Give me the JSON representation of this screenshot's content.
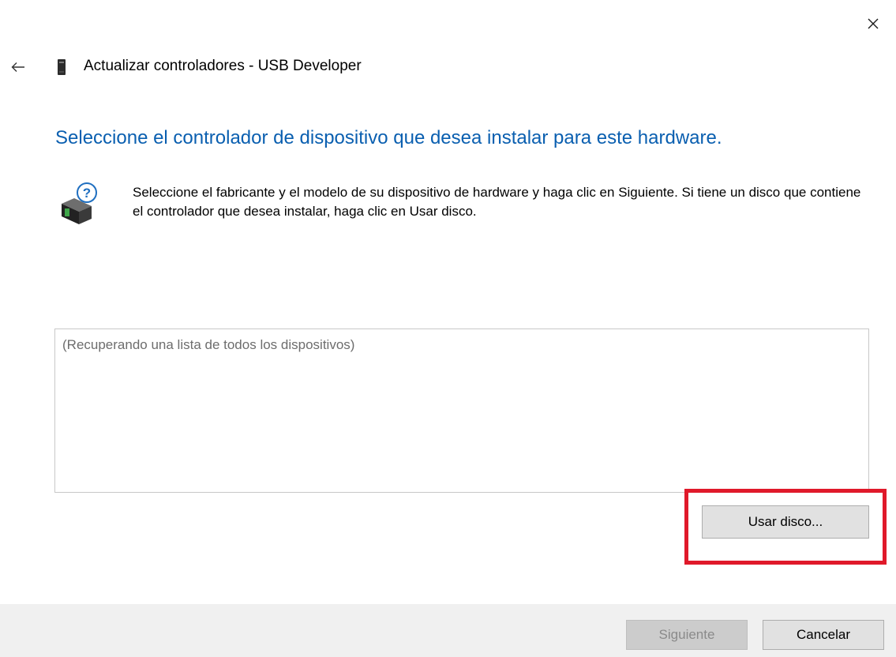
{
  "window": {
    "title": "Actualizar controladores - USB Developer",
    "close_icon": "close-icon",
    "back_icon": "arrow-left-icon",
    "device_icon": "usb-device-icon"
  },
  "main": {
    "heading": "Seleccione el controlador de dispositivo que desea instalar para este hardware.",
    "description": "Seleccione el fabricante y el modelo de su dispositivo de hardware y haga clic en Siguiente. Si tiene un disco que contiene el controlador que desea instalar, haga clic en Usar disco.",
    "info_icon": "hardware-question-icon",
    "device_list_status": "(Recuperando una lista de todos los dispositivos)",
    "use_disk_label": "Usar disco..."
  },
  "footer": {
    "next_label": "Siguiente",
    "cancel_label": "Cancelar"
  },
  "colors": {
    "heading": "#0a5fb0",
    "highlight": "#e0192a",
    "footer_bg": "#f0f0f0"
  }
}
